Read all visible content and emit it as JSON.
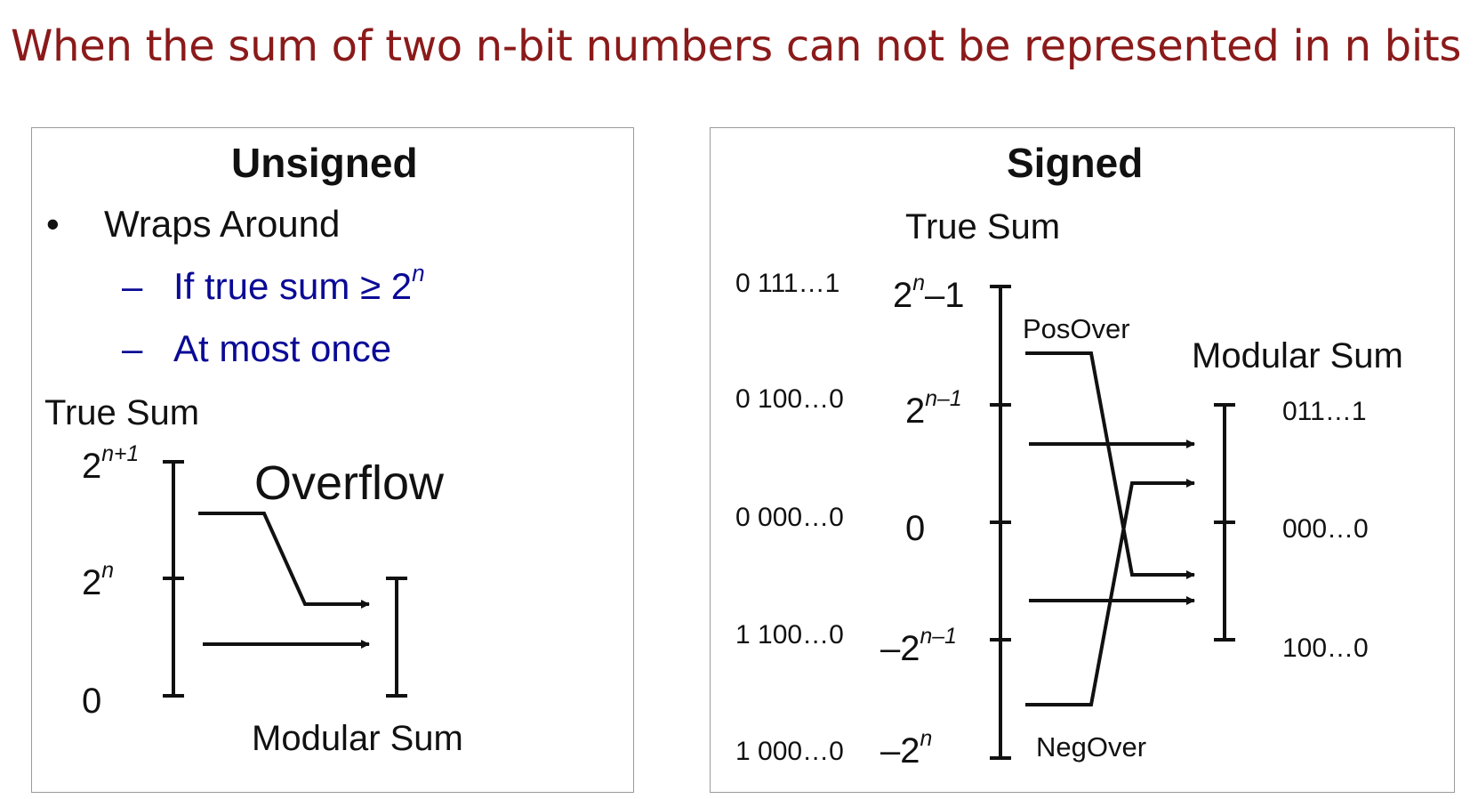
{
  "title": "When the sum of two n-bit numbers can not be represented in n bits",
  "unsigned": {
    "heading": "Unsigned",
    "bullet_marker": "•",
    "bullet": "Wraps Around",
    "dash": "–",
    "sub1_text": "If true sum ≥ 2",
    "sub1_sup": "n",
    "sub2_text": "At most once",
    "true_sum_label": "True Sum",
    "tick_top_base": "2",
    "tick_top_sup": "n+1",
    "tick_mid_base": "2",
    "tick_mid_sup": "n",
    "tick_bottom": "0",
    "overflow_label": "Overflow",
    "modular_sum_label": "Modular Sum"
  },
  "signed": {
    "heading": "Signed",
    "true_sum_label": "True Sum",
    "modular_sum_label": "Modular Sum",
    "pos_over": "PosOver",
    "neg_over": "NegOver",
    "bit_patterns": [
      "0 111…1",
      "0 100…0",
      "0 000…0",
      "1 100…0",
      "1 000…0"
    ],
    "true_ticks": [
      {
        "base": "2",
        "sup": "n",
        "tail": "–1"
      },
      {
        "base": "2",
        "sup": "n–1",
        "tail": ""
      },
      {
        "base": "0",
        "sup": "",
        "tail": ""
      },
      {
        "base": "–2",
        "sup": "n–1",
        "tail": ""
      },
      {
        "base": "–2",
        "sup": "n",
        "tail": ""
      }
    ],
    "modular_ticks": [
      "011…1",
      "000…0",
      "100…0"
    ]
  }
}
